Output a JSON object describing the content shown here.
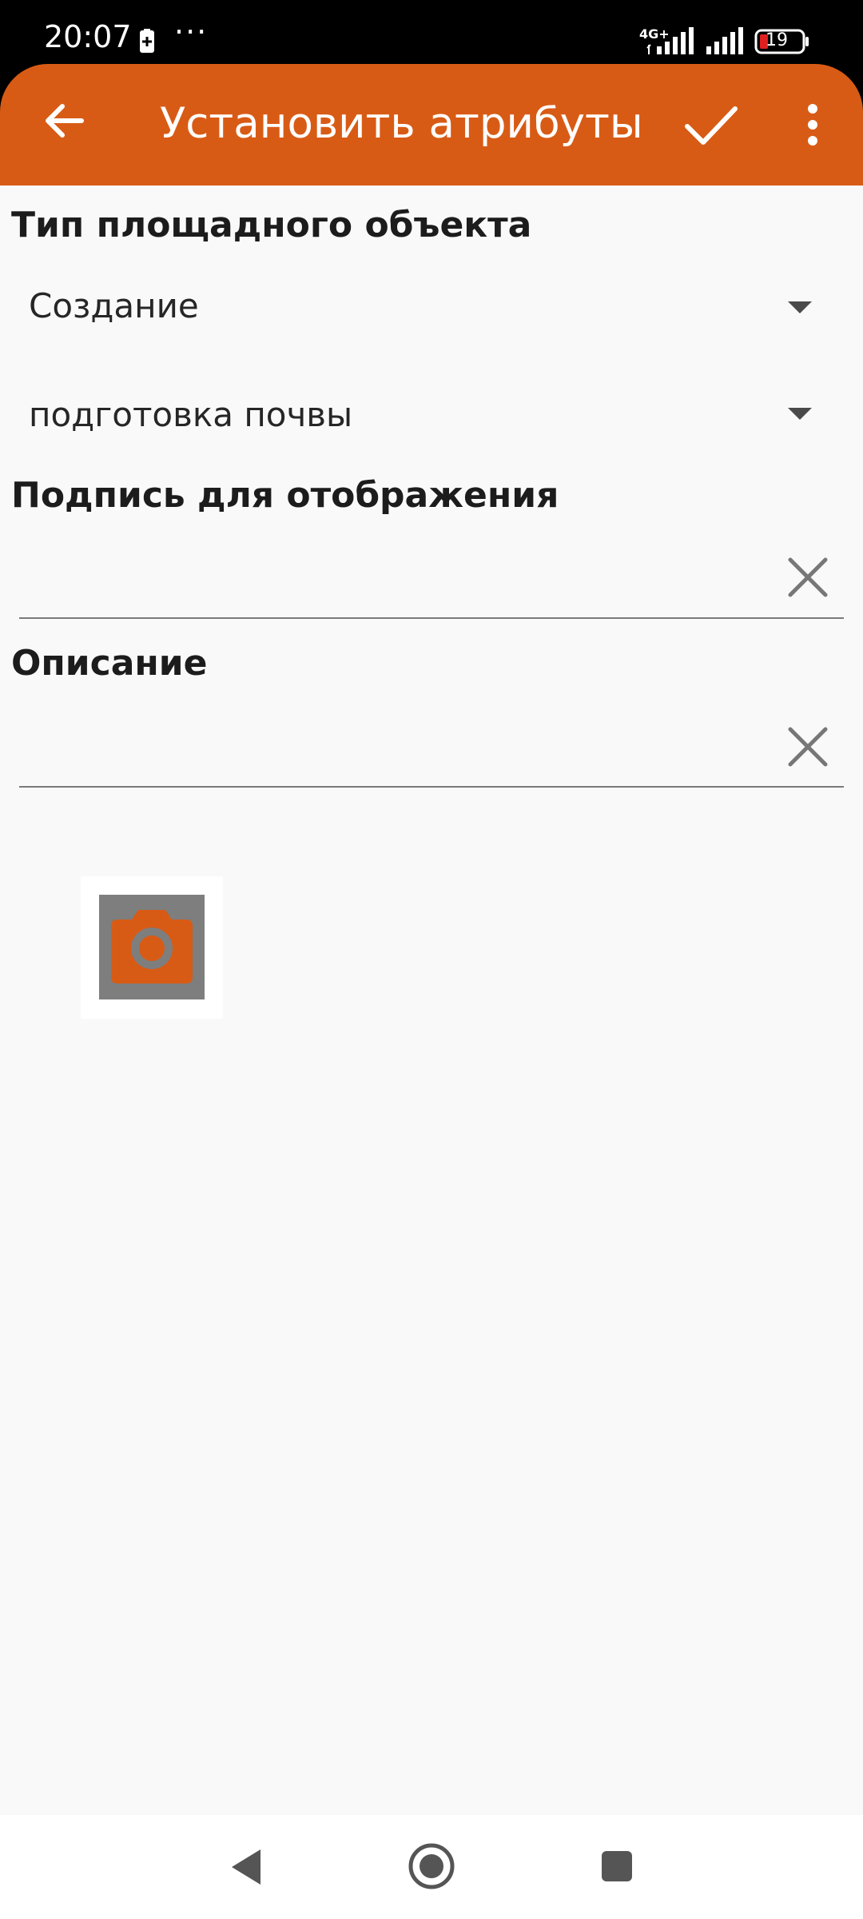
{
  "status_bar": {
    "time": "20:07",
    "more_dots": "···",
    "network": "4G+",
    "battery_level": "19"
  },
  "app_bar": {
    "title": "Установить атрибуты",
    "back_icon": "arrow-left-icon",
    "confirm_icon": "check-icon",
    "more_icon": "more-vert-icon",
    "color": "#D85B15"
  },
  "form": {
    "type_section": {
      "label": "Тип площадного объекта",
      "dropdown1_value": "Создание",
      "dropdown2_value": "подготовка почвы"
    },
    "caption_section": {
      "label": "Подпись для отображения",
      "value": ""
    },
    "description_section": {
      "label": "Описание",
      "value": ""
    },
    "photo_button_icon": "camera-icon"
  },
  "nav_bar": {
    "back_icon": "triangle-back-icon",
    "home_icon": "circle-home-icon",
    "recent_icon": "square-recent-icon"
  },
  "colors": {
    "accent": "#D85B15",
    "background": "#F9F9F9",
    "text": "#1C1C1C"
  }
}
